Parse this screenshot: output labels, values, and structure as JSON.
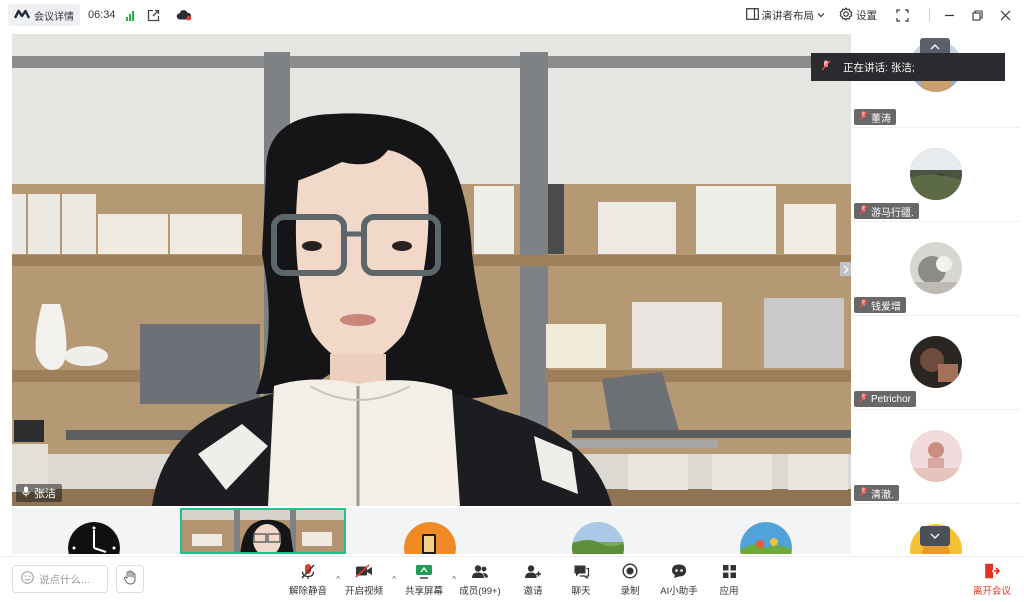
{
  "topbar": {
    "meeting_info_label": "会议详情",
    "timer": "06:34",
    "layout_label": "演讲者布局",
    "settings_label": "设置"
  },
  "main_video": {
    "speaker_name": "张洁"
  },
  "speaker_toast": {
    "text": "正在讲话: 张洁;"
  },
  "sidebar": {
    "participants": [
      {
        "name": "董涛"
      },
      {
        "name": "游马行疆."
      },
      {
        "name": "钱爱增"
      },
      {
        "name": "Petrichor"
      },
      {
        "name": "清澈."
      }
    ]
  },
  "toolbar": {
    "chat_placeholder": "说点什么...",
    "tools": [
      {
        "label": "解除静音",
        "icon": "mic-muted-icon"
      },
      {
        "label": "开启视频",
        "icon": "camera-off-icon"
      },
      {
        "label": "共享屏幕",
        "icon": "share-screen-icon"
      },
      {
        "label": "成员(99+)",
        "icon": "members-icon"
      },
      {
        "label": "邀请",
        "icon": "invite-icon"
      },
      {
        "label": "聊天",
        "icon": "chat-icon"
      },
      {
        "label": "录制",
        "icon": "record-icon"
      },
      {
        "label": "AI小助手",
        "icon": "ai-assistant-icon"
      },
      {
        "label": "应用",
        "icon": "apps-icon"
      }
    ],
    "leave_label": "离开会议"
  },
  "colors": {
    "accent_green": "#22c08a",
    "leave_red": "#e0301e",
    "signal_green": "#27b04a"
  }
}
